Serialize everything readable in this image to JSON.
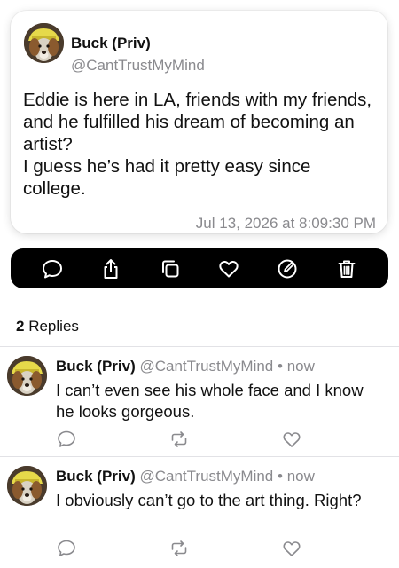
{
  "post": {
    "author_name": "Buck (Priv)",
    "author_handle": "@CantTrustMyMind",
    "text": "Eddie is here in LA, friends with my friends, and he fulfilled his dream of becoming an artist?\nI guess he’s had it pretty easy since college.",
    "timestamp": "Jul 13, 2026 at 8:09:30 PM"
  },
  "action_bar": {
    "icons": [
      "reply-icon",
      "share-icon",
      "copy-icon",
      "like-icon",
      "edit-icon",
      "trash-icon"
    ],
    "background": "#000000"
  },
  "replies_header": {
    "count": "2",
    "label": "Replies"
  },
  "replies": [
    {
      "author_name": "Buck (Priv)",
      "author_handle": "@CantTrustMyMind",
      "separator": "•",
      "age": "now",
      "text": "I can’t even see his whole face and I know he looks gorgeous."
    },
    {
      "author_name": "Buck (Priv)",
      "author_handle": "@CantTrustMyMind",
      "separator": "•",
      "age": "now",
      "text": "I obviously can’t go to the art thing. Right?"
    }
  ],
  "colors": {
    "text": "#111111",
    "secondary": "#8a8a8e",
    "divider": "#e2e2e6"
  }
}
